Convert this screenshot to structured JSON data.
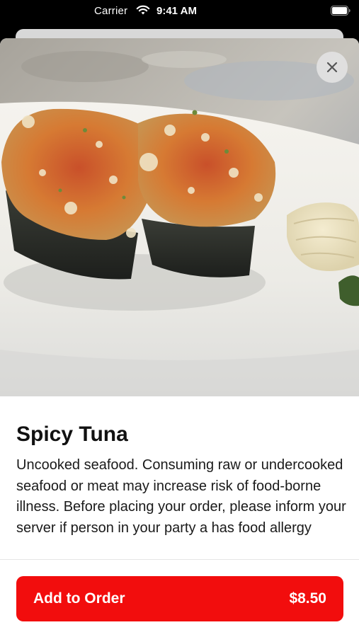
{
  "status_bar": {
    "carrier": "Carrier",
    "time": "9:41 AM",
    "wifi_icon": "wifi-icon",
    "battery_icon": "battery-icon"
  },
  "item": {
    "photo_icon": "sushi-photo",
    "name": "Spicy Tuna",
    "description": "Uncooked seafood. Consuming raw or undercooked seafood or meat may increase risk of food-borne illness. Before placing your order, please inform your server if person in your party a has food allergy"
  },
  "close_icon": "close-icon",
  "order_button": {
    "label": "Add to Order",
    "price": "$8.50"
  },
  "colors": {
    "accent": "#f20d0d",
    "sheet_background": "#ffffff",
    "status_bar_background": "#000000"
  }
}
